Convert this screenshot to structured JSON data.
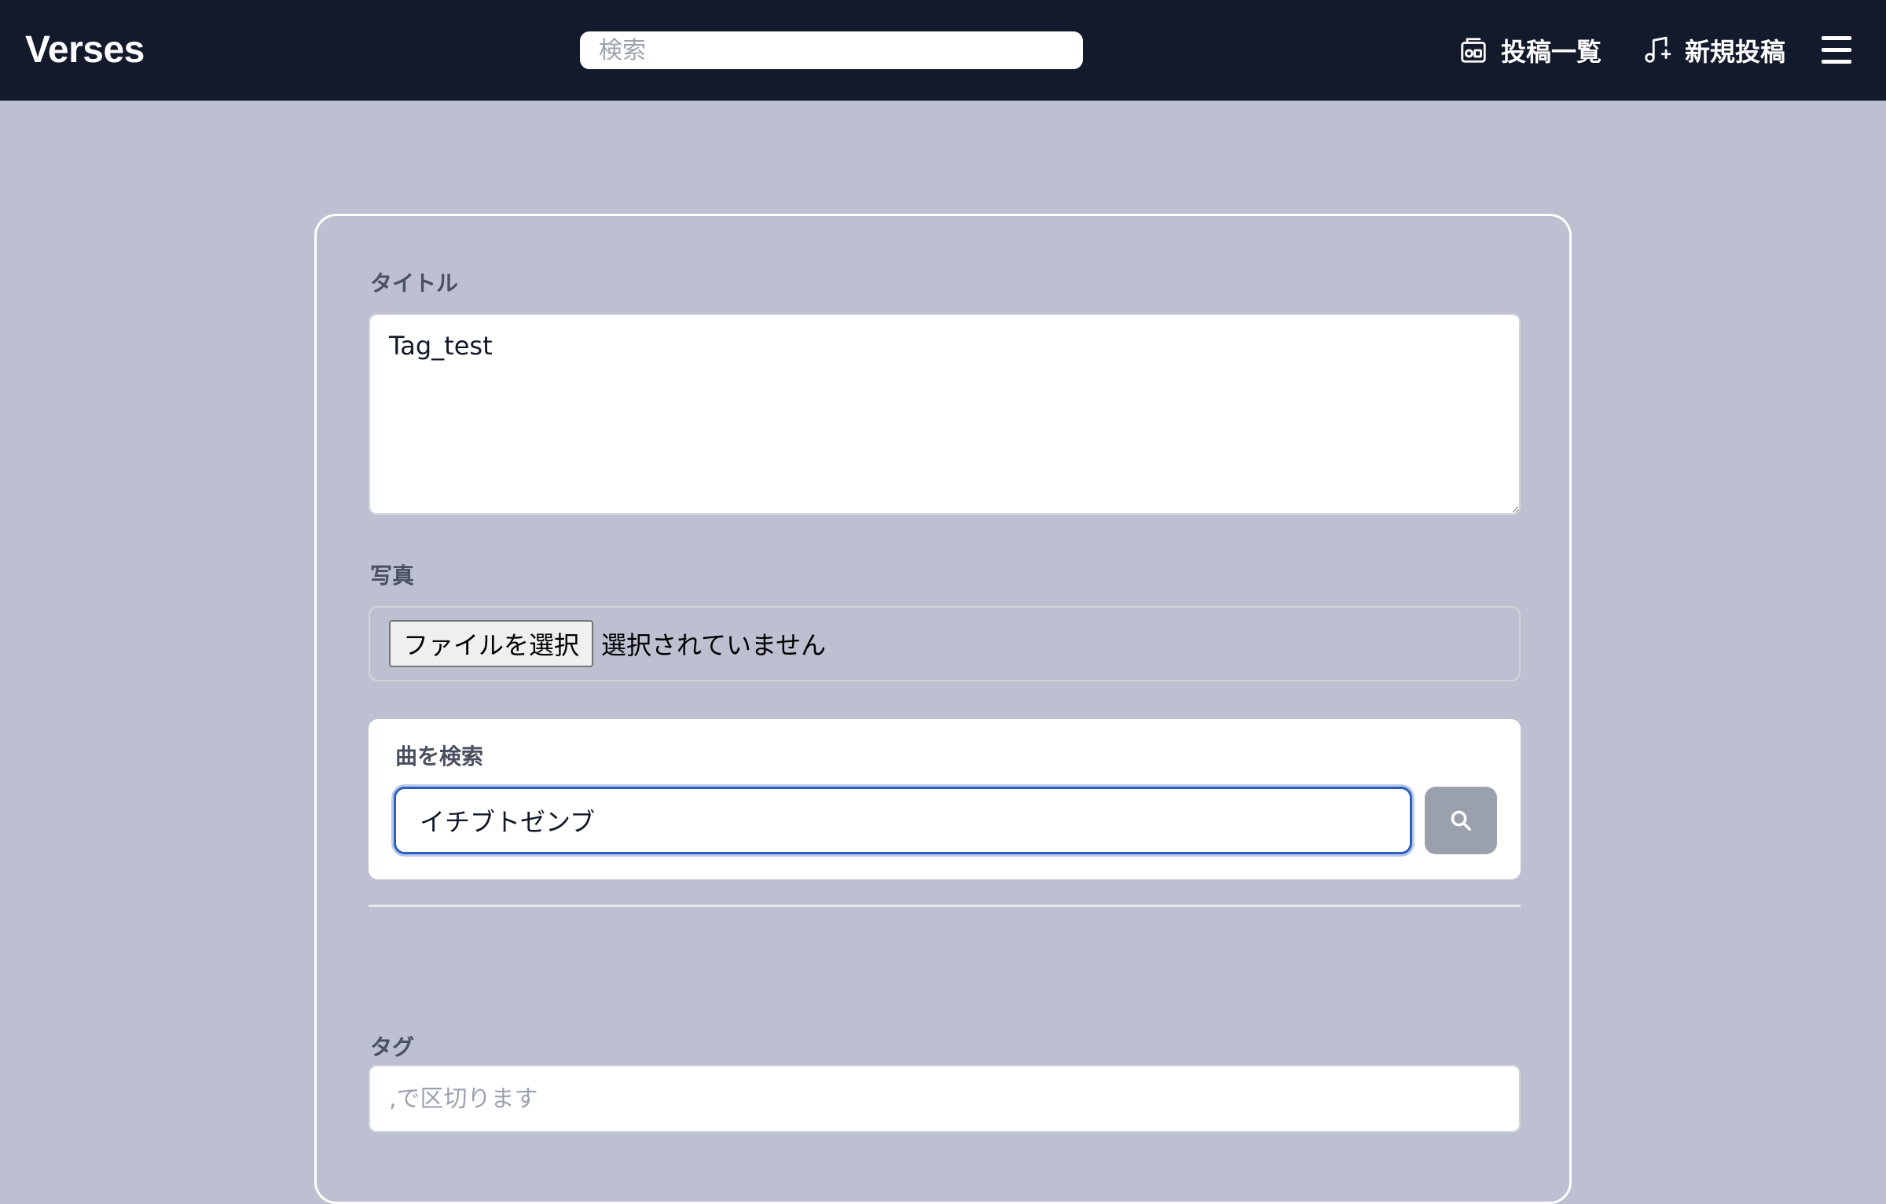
{
  "header": {
    "brand": "Verses",
    "search_placeholder": "検索",
    "nav_posts": "投稿一覧",
    "nav_new_post": "新規投稿"
  },
  "form": {
    "title_label": "タイトル",
    "title_value": "Tag_test",
    "photo_label": "写真",
    "file_button": "ファイルを選択",
    "file_status": "選択されていません",
    "song_search_label": "曲を検索",
    "song_search_value": "イチブトゼンブ",
    "tag_label": "タグ",
    "tag_placeholder": ",で区切ります"
  },
  "icons": {
    "posts": "radio-icon",
    "new_post": "music-plus-icon",
    "menu": "hamburger-menu-icon",
    "song_search": "search-icon"
  },
  "colors": {
    "navbar": "#131a2b",
    "page_background": "#bcc0d1",
    "focus_ring": "#2b5fbf",
    "search_button": "#9aa0ac"
  }
}
